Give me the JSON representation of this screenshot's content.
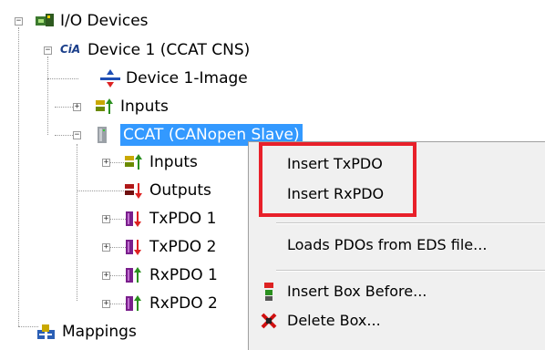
{
  "tree": {
    "io_devices": "I/O Devices",
    "device1": "Device 1 (CCAT CNS)",
    "device1_image": "Device 1-Image",
    "inputs": "Inputs",
    "ccat": "CCAT (CANopen Slave)",
    "ccat_inputs": "Inputs",
    "ccat_outputs": "Outputs",
    "txpdo1": "TxPDO 1",
    "txpdo2": "TxPDO 2",
    "rxpdo1": "RxPDO 1",
    "rxpdo2": "RxPDO 2",
    "mappings": "Mappings",
    "cia_logo": "CiA"
  },
  "menu": {
    "insert_txpdo": "Insert TxPDO",
    "insert_rxpdo": "Insert RxPDO",
    "load_pdos": "Loads PDOs from EDS file...",
    "insert_box_before": "Insert Box Before...",
    "delete_box": "Delete Box..."
  },
  "colors": {
    "selection": "#3399ff",
    "highlight_box": "#e8202a"
  }
}
